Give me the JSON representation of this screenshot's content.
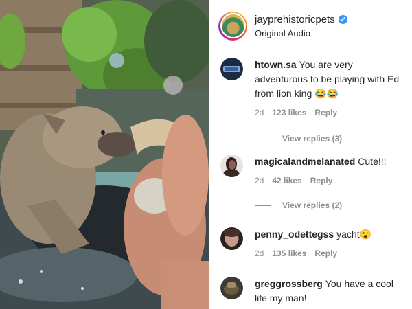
{
  "post": {
    "username": "jayprehistoricpets",
    "subtitle": "Original Audio",
    "verified": true,
    "verified_color": "#3897f0"
  },
  "comments": [
    {
      "user": "htown.sa",
      "text": "You are very adventurous to be playing with Ed from lion king 😂😂",
      "time": "2d",
      "likes": "123 likes",
      "reply": "Reply",
      "view_replies": "View replies (3)"
    },
    {
      "user": "magicalandmelanated",
      "text": "Cute!!!",
      "time": "2d",
      "likes": "42 likes",
      "reply": "Reply",
      "view_replies": "View replies (2)"
    },
    {
      "user": "penny_odettegss",
      "text": "yacht😮",
      "time": "2d",
      "likes": "135 likes",
      "reply": "Reply"
    },
    {
      "user": "greggrossberg",
      "text": "You have a cool life my man!"
    }
  ],
  "colors": {
    "text": "#262626",
    "muted": "#8e8e8e",
    "divider": "#efefef"
  }
}
